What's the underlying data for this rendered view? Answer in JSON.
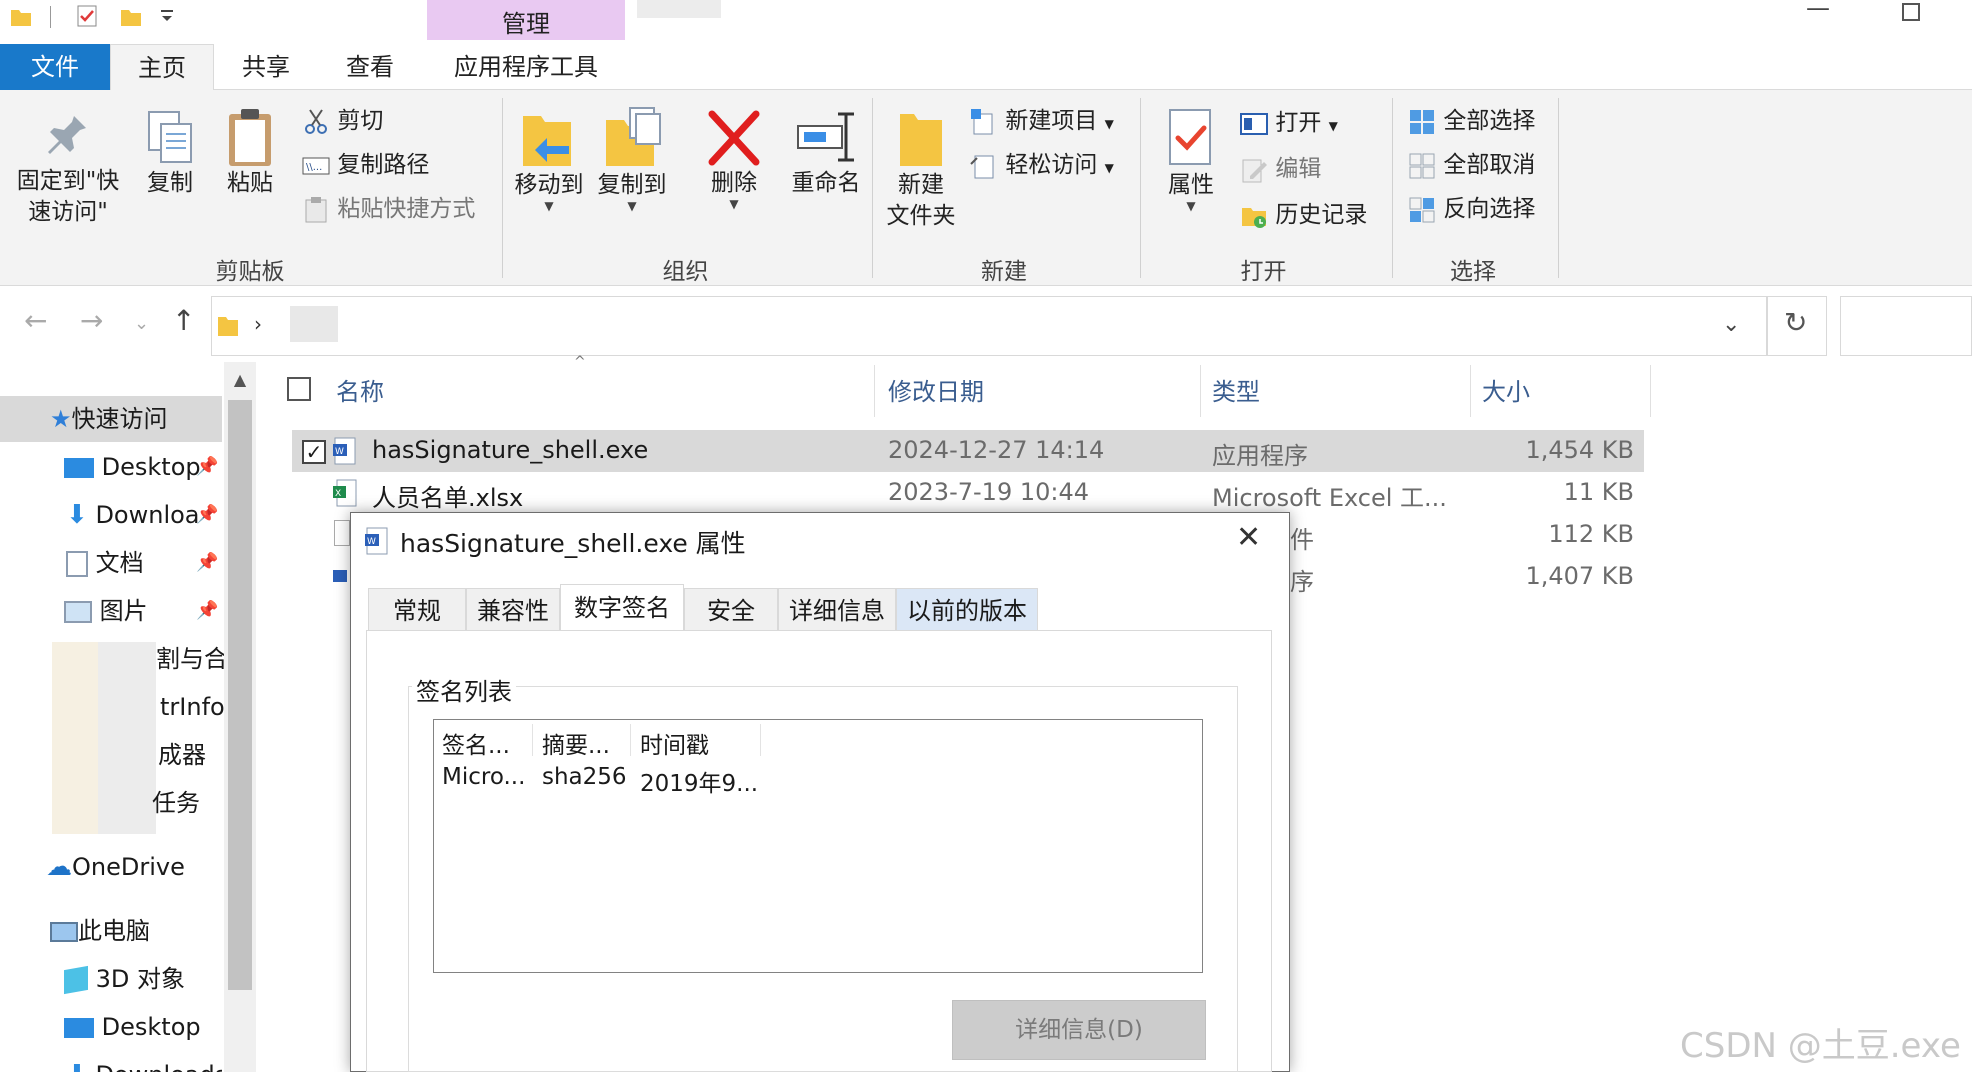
{
  "ribbon_tabs": {
    "manage": "管理",
    "file": "文件",
    "home": "主页",
    "share": "共享",
    "view": "查看",
    "app_tools": "应用程序工具"
  },
  "ribbon": {
    "clipboard": {
      "pin_line1": "固定到\"快",
      "pin_line2": "速访问\"",
      "copy": "复制",
      "paste": "粘贴",
      "cut": "剪切",
      "copy_path": "复制路径",
      "paste_shortcut": "粘贴快捷方式",
      "group": "剪贴板"
    },
    "organize": {
      "move_to": "移动到",
      "copy_to": "复制到",
      "delete": "删除",
      "rename": "重命名",
      "group": "组织"
    },
    "new": {
      "new_folder_line1": "新建",
      "new_folder_line2": "文件夹",
      "new_item": "新建项目",
      "easy_access": "轻松访问",
      "group": "新建"
    },
    "open": {
      "properties": "属性",
      "open": "打开",
      "edit": "编辑",
      "history": "历史记录",
      "group": "打开"
    },
    "select": {
      "select_all": "全部选择",
      "select_none": "全部取消",
      "invert": "反向选择",
      "group": "选择"
    }
  },
  "nav": {
    "quick_access": "快速访问",
    "desktop": "Desktop",
    "downloads": "Downloa",
    "documents": "文档",
    "pictures": "图片",
    "partial1": "割与合",
    "partial2": "trInfo",
    "partial3": "成器",
    "partial4": "任务",
    "onedrive": "OneDrive",
    "this_pc": "此电脑",
    "objects3d": "3D 对象",
    "desktop2": "Desktop",
    "downloads2": "Downloads"
  },
  "file_list": {
    "columns": {
      "name": "名称",
      "modified": "修改日期",
      "type": "类型",
      "size": "大小"
    },
    "rows": [
      {
        "name": "hasSignature_shell.exe",
        "modified": "2024-12-27 14:14",
        "type": "应用程序",
        "size": "1,454 KB"
      },
      {
        "name": "人员名单.xlsx",
        "modified": "2023-7-19 10:44",
        "type": "Microsoft Excel 工...",
        "size": "11 KB"
      },
      {
        "name": "",
        "modified": "",
        "type": "件",
        "size": "112 KB"
      },
      {
        "name": "",
        "modified": "",
        "type": "序",
        "size": "1,407 KB"
      }
    ]
  },
  "dialog": {
    "title": "hasSignature_shell.exe 属性",
    "tabs": [
      "常规",
      "兼容性",
      "数字签名",
      "安全",
      "详细信息",
      "以前的版本"
    ],
    "signature_list_label": "签名列表",
    "list_headers": [
      "签名...",
      "摘要...",
      "时间戳"
    ],
    "list_row": [
      "Micro...",
      "sha256",
      "2019年9..."
    ],
    "details_button": "详细信息(D)"
  },
  "watermark": "CSDN @土豆.exe",
  "colors": {
    "file_tab": "#1979ca",
    "manage_band": "#e9c9f2",
    "selection": "#d9d9d9",
    "header_text": "#3a5d8f"
  }
}
